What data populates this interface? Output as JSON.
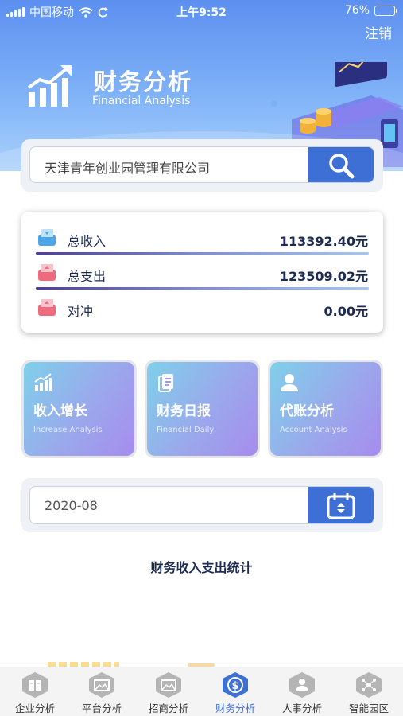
{
  "status_bar": {
    "carrier": "中国移动",
    "time": "上午9:52",
    "battery": "76%",
    "battery_level": 0.76
  },
  "header": {
    "logout_label": "注销",
    "title": "财务分析",
    "subtitle": "Financial Analysis"
  },
  "search": {
    "value": "天津青年创业园管理有限公司",
    "button_icon": "search-icon"
  },
  "summary": {
    "rows": [
      {
        "label": "总收入",
        "value": "113392.40元",
        "icon": "inbox-in-icon",
        "color": "#4aa6e8"
      },
      {
        "label": "总支出",
        "value": "123509.02元",
        "icon": "inbox-out-icon",
        "color": "#ef6a7d"
      },
      {
        "label": "对冲",
        "value": "0.00元",
        "icon": "inbox-offset-icon",
        "color": "#ef6a7d"
      }
    ]
  },
  "cards": [
    {
      "title": "收入增长",
      "subtitle": "Increase Analysis",
      "icon": "bar-chart-icon"
    },
    {
      "title": "财务日报",
      "subtitle": "Financial Daily",
      "icon": "document-icon"
    },
    {
      "title": "代账分析",
      "subtitle": "Account Analysis",
      "icon": "person-icon"
    }
  ],
  "date_picker": {
    "value": "2020-08",
    "button_icon": "calendar-icon"
  },
  "section": {
    "title": "财务收入支出统计"
  },
  "tabs": [
    {
      "label": "企业分析",
      "icon": "book-icon",
      "active": false
    },
    {
      "label": "平台分析",
      "icon": "picture-icon",
      "active": false
    },
    {
      "label": "招商分析",
      "icon": "picture-icon",
      "active": false
    },
    {
      "label": "财务分析",
      "icon": "dollar-icon",
      "active": true
    },
    {
      "label": "人事分析",
      "icon": "people-icon",
      "active": false
    },
    {
      "label": "智能园区",
      "icon": "network-icon",
      "active": false
    }
  ],
  "colors": {
    "accent": "#3d6fd4",
    "header_gradient_top": "#5d8ff0",
    "header_gradient_bottom": "#a9d0fb",
    "text_dark": "#1d2b52"
  }
}
